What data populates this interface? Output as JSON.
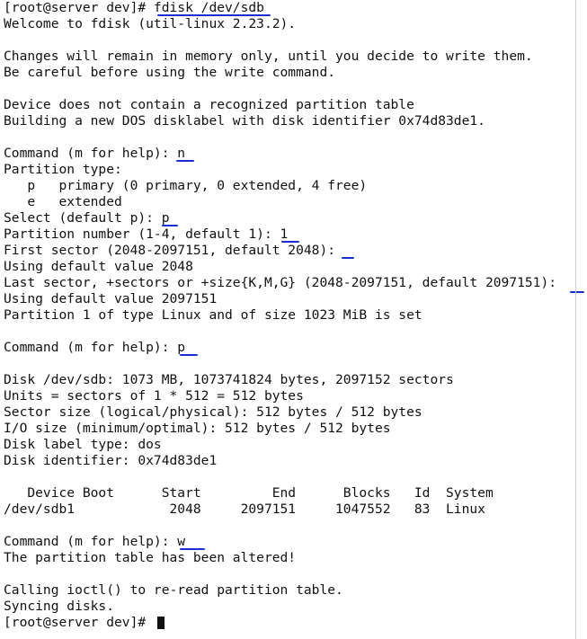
{
  "terminal": {
    "lines": [
      "[root@server dev]# fdisk /dev/sdb",
      "Welcome to fdisk (util-linux 2.23.2).",
      "",
      "Changes will remain in memory only, until you decide to write them.",
      "Be careful before using the write command.",
      "",
      "Device does not contain a recognized partition table",
      "Building a new DOS disklabel with disk identifier 0x74d83de1.",
      "",
      "Command (m for help): n",
      "Partition type:",
      "   p   primary (0 primary, 0 extended, 4 free)",
      "   e   extended",
      "Select (default p): p",
      "Partition number (1-4, default 1): 1",
      "First sector (2048-2097151, default 2048):",
      "Using default value 2048",
      "Last sector, +sectors or +size{K,M,G} (2048-2097151, default 2097151):",
      "Using default value 2097151",
      "Partition 1 of type Linux and of size 1023 MiB is set",
      "",
      "Command (m for help): p",
      "",
      "Disk /dev/sdb: 1073 MB, 1073741824 bytes, 2097152 sectors",
      "Units = sectors of 1 * 512 = 512 bytes",
      "Sector size (logical/physical): 512 bytes / 512 bytes",
      "I/O size (minimum/optimal): 512 bytes / 512 bytes",
      "Disk label type: dos",
      "Disk identifier: 0x74d83de1",
      "",
      "   Device Boot      Start         End      Blocks   Id  System",
      "/dev/sdb1            2048     2097151     1047552   83  Linux",
      "",
      "Command (m for help): w",
      "The partition table has been altered!",
      "",
      "Calling ioctl() to re-read partition table.",
      "Syncing disks.",
      "[root@server dev]# "
    ]
  },
  "colors": {
    "background": "#ffffff",
    "text": "#111111",
    "annotation_ink": "#1a2fd0"
  }
}
